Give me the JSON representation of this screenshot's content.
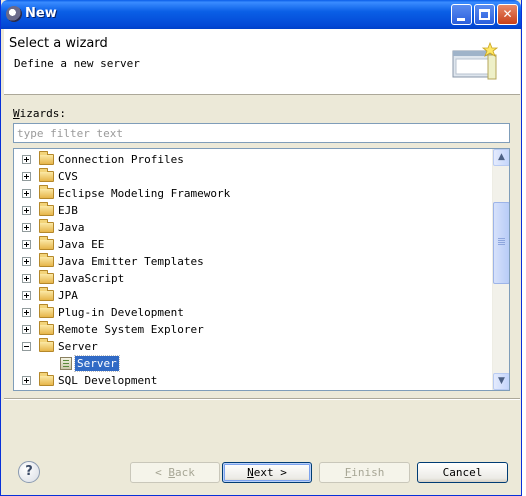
{
  "window": {
    "title": "New"
  },
  "banner": {
    "title": "Select a wizard",
    "description": "Define a new server"
  },
  "filter": {
    "label_mnemonic": "W",
    "label_rest": "izards:",
    "placeholder": "type filter text",
    "value": ""
  },
  "tree": {
    "items": [
      {
        "label": "Connection Profiles",
        "expanded": false
      },
      {
        "label": "CVS",
        "expanded": false
      },
      {
        "label": "Eclipse Modeling Framework",
        "expanded": false
      },
      {
        "label": "EJB",
        "expanded": false
      },
      {
        "label": "Java",
        "expanded": false
      },
      {
        "label": "Java EE",
        "expanded": false
      },
      {
        "label": "Java Emitter Templates",
        "expanded": false
      },
      {
        "label": "JavaScript",
        "expanded": false
      },
      {
        "label": "JPA",
        "expanded": false
      },
      {
        "label": "Plug-in Development",
        "expanded": false
      },
      {
        "label": "Remote System Explorer",
        "expanded": false
      },
      {
        "label": "Server",
        "expanded": true
      },
      {
        "label": "Server",
        "child": true,
        "selected": true
      },
      {
        "label": "SQL Development",
        "expanded": false
      }
    ]
  },
  "buttons": {
    "back_mnemonic": "B",
    "back_rest": "ack",
    "back_prefix": "< ",
    "next_mnemonic": "N",
    "next_rest": "ext >",
    "finish_mnemonic": "F",
    "finish_rest": "inish",
    "cancel": "Cancel",
    "help": "?"
  },
  "colors": {
    "selection": "#316ac5",
    "titlebar": "#0a5fe6",
    "dialog_bg": "#ece9d8"
  }
}
